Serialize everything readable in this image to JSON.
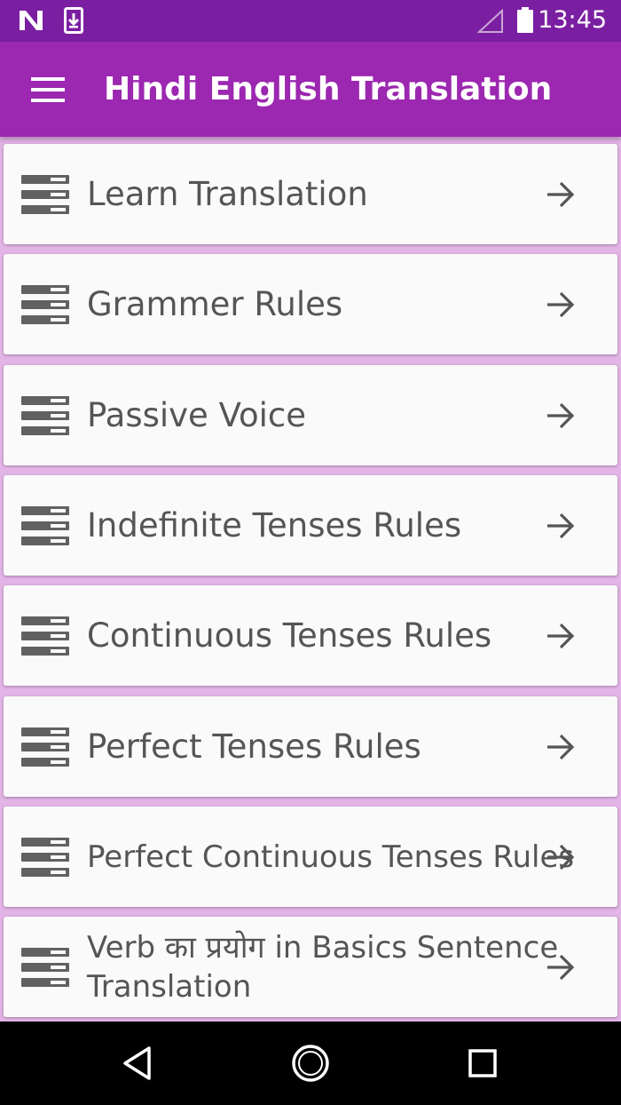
{
  "status_bar": {
    "time": "13:45",
    "left_icons": [
      "notification-n-icon",
      "download-notification-icon"
    ],
    "right_icons": [
      "signal-icon",
      "battery-icon"
    ]
  },
  "app_bar": {
    "title": "Hindi English Translation",
    "menu_icon": "hamburger-menu-icon",
    "color": "#9C27B0",
    "status_color": "#7B1FA2"
  },
  "list": {
    "items": [
      {
        "label": "Learn Translation",
        "icon": "list-icon",
        "action_icon": "arrow-right-icon"
      },
      {
        "label": "Grammer Rules",
        "icon": "list-icon",
        "action_icon": "arrow-right-icon"
      },
      {
        "label": "Passive Voice",
        "icon": "list-icon",
        "action_icon": "arrow-right-icon"
      },
      {
        "label": "Indefinite Tenses Rules",
        "icon": "list-icon",
        "action_icon": "arrow-right-icon"
      },
      {
        "label": "Continuous Tenses Rules",
        "icon": "list-icon",
        "action_icon": "arrow-right-icon"
      },
      {
        "label": "Perfect Tenses Rules",
        "icon": "list-icon",
        "action_icon": "arrow-right-icon"
      },
      {
        "label": "Perfect Continuous Tenses Rules",
        "icon": "list-icon",
        "action_icon": "arrow-right-icon"
      },
      {
        "label": "Verb का प्रयोग in Basics Sentence Translation",
        "icon": "list-icon",
        "action_icon": "arrow-right-icon"
      }
    ],
    "background": "#E3B4E6"
  },
  "nav_bar": {
    "buttons": [
      "back-triangle-icon",
      "home-circle-icon",
      "recents-square-icon"
    ]
  }
}
